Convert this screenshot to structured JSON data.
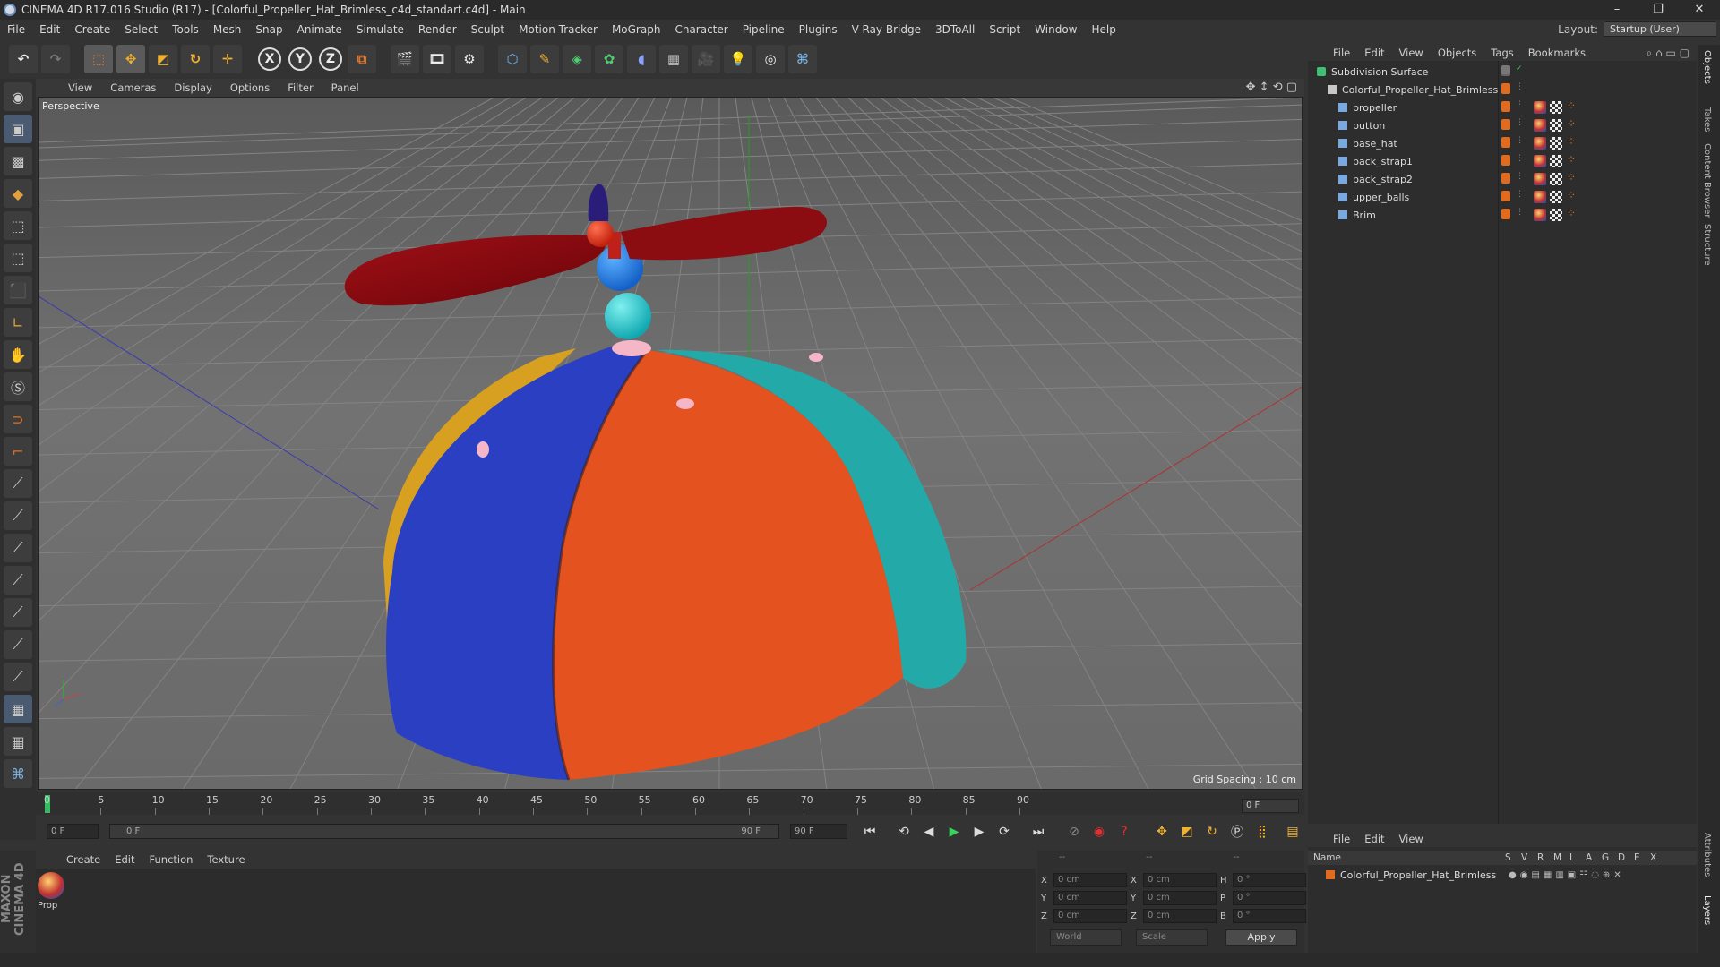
{
  "window": {
    "title": "CINEMA 4D R17.016 Studio (R17) - [Colorful_Propeller_Hat_Brimless_c4d_standart.c4d] - Main",
    "min": "–",
    "restore": "❐",
    "close": "✕"
  },
  "menu": [
    "File",
    "Edit",
    "Create",
    "Select",
    "Tools",
    "Mesh",
    "Snap",
    "Animate",
    "Simulate",
    "Render",
    "Sculpt",
    "Motion Tracker",
    "MoGraph",
    "Character",
    "Pipeline",
    "Plugins",
    "V-Ray Bridge",
    "3DToAll",
    "Script",
    "Window",
    "Help"
  ],
  "layout": {
    "label": "Layout:",
    "value": "Startup (User)"
  },
  "toolbar": {
    "x": "X",
    "y": "Y",
    "z": "Z"
  },
  "viewport": {
    "menu": [
      "View",
      "Cameras",
      "Display",
      "Options",
      "Filter",
      "Panel"
    ],
    "label": "Perspective",
    "grid_spacing": "Grid Spacing : 10 cm",
    "colors": {
      "red": "#8b0d12",
      "blue": "#2a3fc2",
      "orange": "#e3521f",
      "teal": "#23aaa8",
      "yellow": "#d8a020",
      "ball_blue": "#1e78e0",
      "ball_teal": "#21c4c8",
      "pink": "#f5b6c8",
      "navy": "#2a1d7a"
    }
  },
  "timeline": {
    "ticks": [
      "0",
      "5",
      "10",
      "15",
      "20",
      "25",
      "30",
      "35",
      "40",
      "45",
      "50",
      "55",
      "60",
      "65",
      "70",
      "75",
      "80",
      "85",
      "90"
    ],
    "end_frame": "0 F",
    "start_field": "0 F",
    "range_start": "0 F",
    "range_end": "90 F",
    "end_field": "90 F"
  },
  "material_manager": {
    "menu": [
      "Create",
      "Edit",
      "Function",
      "Texture"
    ],
    "materials": [
      {
        "label": "Prop"
      }
    ]
  },
  "coordinates": {
    "header": [
      "--",
      "--",
      "--"
    ],
    "rows": [
      {
        "a": "X",
        "av": "0 cm",
        "b": "X",
        "bv": "0 cm",
        "c": "H",
        "cv": "0 °"
      },
      {
        "a": "Y",
        "av": "0 cm",
        "b": "Y",
        "bv": "0 cm",
        "c": "P",
        "cv": "0 °"
      },
      {
        "a": "Z",
        "av": "0 cm",
        "b": "Z",
        "bv": "0 cm",
        "c": "B",
        "cv": "0 °"
      }
    ],
    "world": "World",
    "scale": "Scale",
    "apply": "Apply"
  },
  "object_manager": {
    "menu": [
      "File",
      "Edit",
      "View",
      "Objects",
      "Tags",
      "Bookmarks"
    ],
    "objects": [
      {
        "name": "Subdivision Surface",
        "level": 0
      },
      {
        "name": "Colorful_Propeller_Hat_Brimless",
        "level": 1
      },
      {
        "name": "propeller",
        "level": 2
      },
      {
        "name": "button",
        "level": 2
      },
      {
        "name": "base_hat",
        "level": 2
      },
      {
        "name": "back_strap1",
        "level": 2
      },
      {
        "name": "back_strap2",
        "level": 2
      },
      {
        "name": "upper_balls",
        "level": 2
      },
      {
        "name": "Brim",
        "level": 2
      }
    ]
  },
  "layer_manager": {
    "menu": [
      "File",
      "Edit",
      "View"
    ],
    "columns": [
      "Name",
      "S",
      "V",
      "R",
      "M",
      "L",
      "A",
      "G",
      "D",
      "E",
      "X"
    ],
    "layers": [
      {
        "name": "Colorful_Propeller_Hat_Brimless",
        "color": "#e06a1e"
      }
    ]
  },
  "side_tabs": [
    "Objects",
    "Takes",
    "Content Browser",
    "Structure",
    "Attributes",
    "Layers"
  ],
  "brand": "MAXON CINEMA 4D"
}
